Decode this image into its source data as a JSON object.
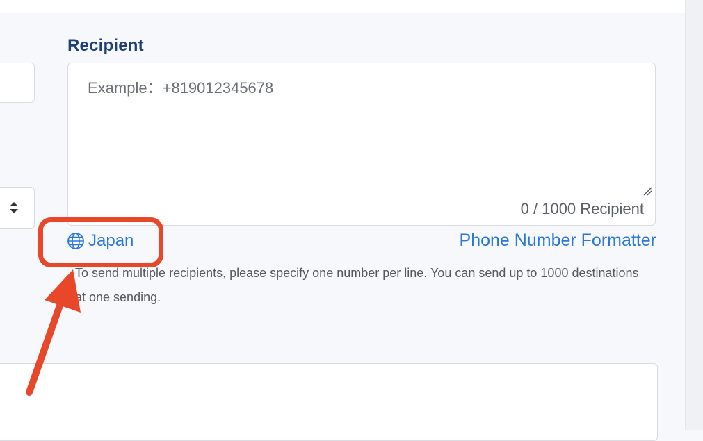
{
  "recipient": {
    "label": "Recipient",
    "placeholder": "Example：+819012345678",
    "value": "",
    "counter": "0 / 1000 Recipient"
  },
  "country": {
    "label": "Japan",
    "icon": "globe-icon"
  },
  "formatter": {
    "label": "Phone Number Formatter"
  },
  "help": {
    "text": "To send multiple recipients, please specify one number per line. You can send up to 1000 destinations at one sending."
  },
  "annotation": {
    "color": "#e8472a"
  },
  "colors": {
    "label": "#1f3f78",
    "link": "#2a78d8",
    "background": "#f7f8fc"
  }
}
